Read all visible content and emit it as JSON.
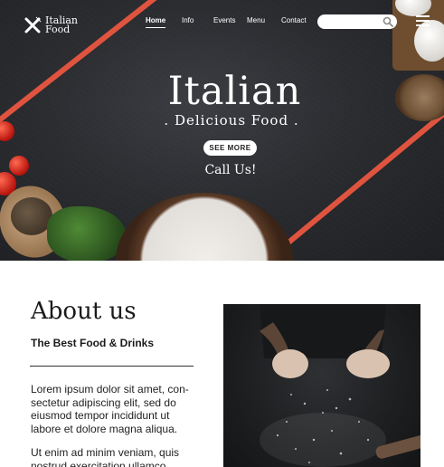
{
  "brand": {
    "line1": "Italian",
    "line2": "Food"
  },
  "nav": {
    "items": [
      {
        "label": "Home",
        "active": true
      },
      {
        "label": "Info",
        "active": false
      },
      {
        "label": "Events",
        "active": false
      },
      {
        "label": "Menu",
        "active": false
      },
      {
        "label": "Contact",
        "active": false
      }
    ]
  },
  "search": {
    "placeholder": "",
    "icon": "search-icon"
  },
  "menu_icon": "hamburger-icon",
  "hero": {
    "title": "Italian",
    "subtitle": ". Delicious Food .",
    "cta_label": "SEE MORE",
    "call_label": "Call Us!"
  },
  "about": {
    "title": "About us",
    "subtitle": "The Best Food & Drinks",
    "paragraph1": "Lorem ipsum dolor sit amet, con-sectetur adipiscing elit, sed do eiusmod tempor incididunt ut labore et dolore magna aliqua.",
    "paragraph2": "Ut enim ad minim veniam, quis nostrud exercitation ullamco"
  },
  "colors": {
    "accent": "#e0543f",
    "hero_bg": "#2a2c30",
    "text_dark": "#1a1a1a"
  }
}
